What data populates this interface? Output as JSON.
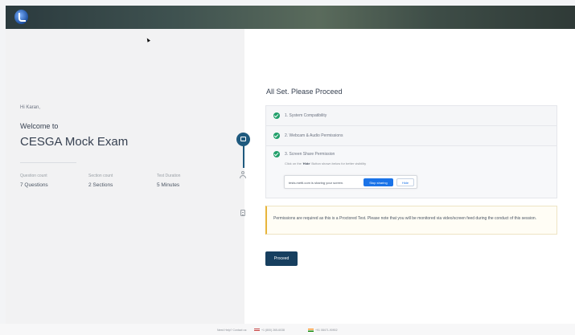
{
  "left": {
    "greeting": "Hi Karan,",
    "welcome": "Welcome to",
    "exam_title": "CESGA Mock Exam",
    "stats": [
      {
        "label": "Question count",
        "value": "7 Questions"
      },
      {
        "label": "Section count",
        "value": "2 Sections"
      },
      {
        "label": "Test Duration",
        "value": "5 Minutes"
      }
    ]
  },
  "main": {
    "heading": "All Set. Please Proceed",
    "checks": [
      {
        "label": "1. System Compatibility"
      },
      {
        "label": "2. Webcam & Audio Permissions"
      },
      {
        "label": "3. Screen Share Permission"
      }
    ],
    "hint_prefix": "Click on the '",
    "hint_bold": "Hide",
    "hint_suffix": "' Button shown below for better visibility",
    "share_bar": {
      "text": "tests.mettl.com is sharing your screen.",
      "stop_label": "Stop sharing",
      "hide_label": "Hide"
    },
    "notice": "Permissions are required as this is a Proctored Test. Please note that you will be monitored via video/screen feed during the conduct of this session.",
    "proceed_label": "Proceed"
  },
  "footer": {
    "help_text": "Need Help? Contact us:",
    "phone_us": "+1 (800) 265-6038",
    "phone_in": "+91 08471-90902"
  },
  "colors": {
    "primary": "#173f5f",
    "success": "#22a06b",
    "warning": "#e7b43a",
    "share_blue": "#1a73e8"
  }
}
